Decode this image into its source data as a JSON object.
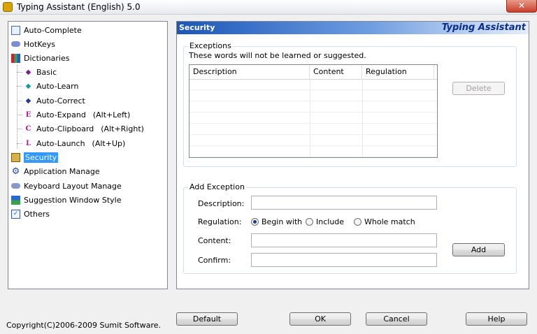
{
  "window": {
    "title": "Typing Assistant (English) 5.0",
    "close_glyph": "✕"
  },
  "tree": {
    "items": [
      {
        "label": "Auto-Complete",
        "icon": "document-check-icon"
      },
      {
        "label": "HotKeys",
        "icon": "keyboard-icon"
      },
      {
        "label": "Dictionaries",
        "icon": "books-icon"
      },
      {
        "label": "Basic",
        "icon": "diamond-icon"
      },
      {
        "label": "Auto-Learn",
        "icon": "diamond-arrow-icon"
      },
      {
        "label": "Auto-Correct",
        "icon": "diamond-icon"
      },
      {
        "label": "Auto-Expand",
        "hotkey": "(Alt+Left)",
        "icon": "letter-e-icon",
        "glyph": "E"
      },
      {
        "label": "Auto-Clipboard",
        "hotkey": "(Alt+Right)",
        "icon": "letter-c-icon",
        "glyph": "C"
      },
      {
        "label": "Auto-Launch",
        "hotkey": "(Alt+Up)",
        "icon": "letter-l-icon",
        "glyph": "L"
      },
      {
        "label": "Security",
        "icon": "security-icon"
      },
      {
        "label": "Application Manage",
        "icon": "gear-icon"
      },
      {
        "label": "Keyboard Layout Manage",
        "icon": "keyboard-layout-icon"
      },
      {
        "label": "Suggestion Window Style",
        "icon": "window-style-icon"
      },
      {
        "label": "Others",
        "icon": "checklist-icon"
      }
    ]
  },
  "panel": {
    "section_title": "Security",
    "brand": "Typing Assistant",
    "exceptions": {
      "legend": "Exceptions",
      "note": "These words will not be learned or suggested.",
      "columns": [
        "Description",
        "Content",
        "Regulation"
      ],
      "delete_label": "Delete"
    },
    "add_exception": {
      "legend": "Add Exception",
      "description_label": "Description:",
      "description_value": "",
      "regulation_label": "Regulation:",
      "options": [
        "Begin with",
        "Include",
        "Whole match"
      ],
      "selected_option": "Begin with",
      "content_label": "Content:",
      "content_value": "",
      "confirm_label": "Confirm:",
      "confirm_value": "",
      "add_label": "Add"
    }
  },
  "footer": {
    "copyright": "Copyright(C)2006-2009 Sumit Software.",
    "default_label": "Default",
    "ok_label": "OK",
    "cancel_label": "Cancel",
    "help_label": "Help"
  },
  "colors": {
    "selection": "#3399ff",
    "header_start": "#1b56b8",
    "brand_text": "#0b2c8a"
  }
}
